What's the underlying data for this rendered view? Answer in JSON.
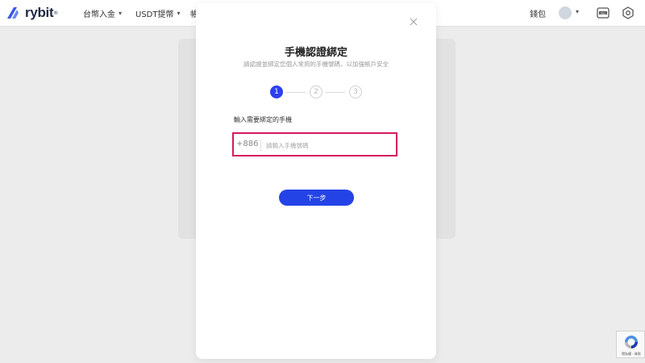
{
  "header": {
    "logo_text": "rybit",
    "logo_reg": "®",
    "nav": [
      {
        "label": "台幣入金"
      },
      {
        "label": "USDT提幣"
      },
      {
        "label": "帳"
      }
    ],
    "wallet_label": "錢包"
  },
  "modal": {
    "title": "手機認證綁定",
    "subtitle": "請認證並綁定您個人常用的手機號碼，以加強帳戶安全",
    "steps": [
      "1",
      "2",
      "3"
    ],
    "active_step": 1,
    "field_label": "輸入需要綁定的手機",
    "country_code": "+886",
    "phone_placeholder": "請輸入手機號碼",
    "phone_value": "",
    "next_label": "下一步"
  },
  "recaptcha": {
    "text": "隱私權 - 條款"
  },
  "colors": {
    "accent": "#2443e6",
    "highlight_border": "#d6195f",
    "background": "#ececec"
  }
}
